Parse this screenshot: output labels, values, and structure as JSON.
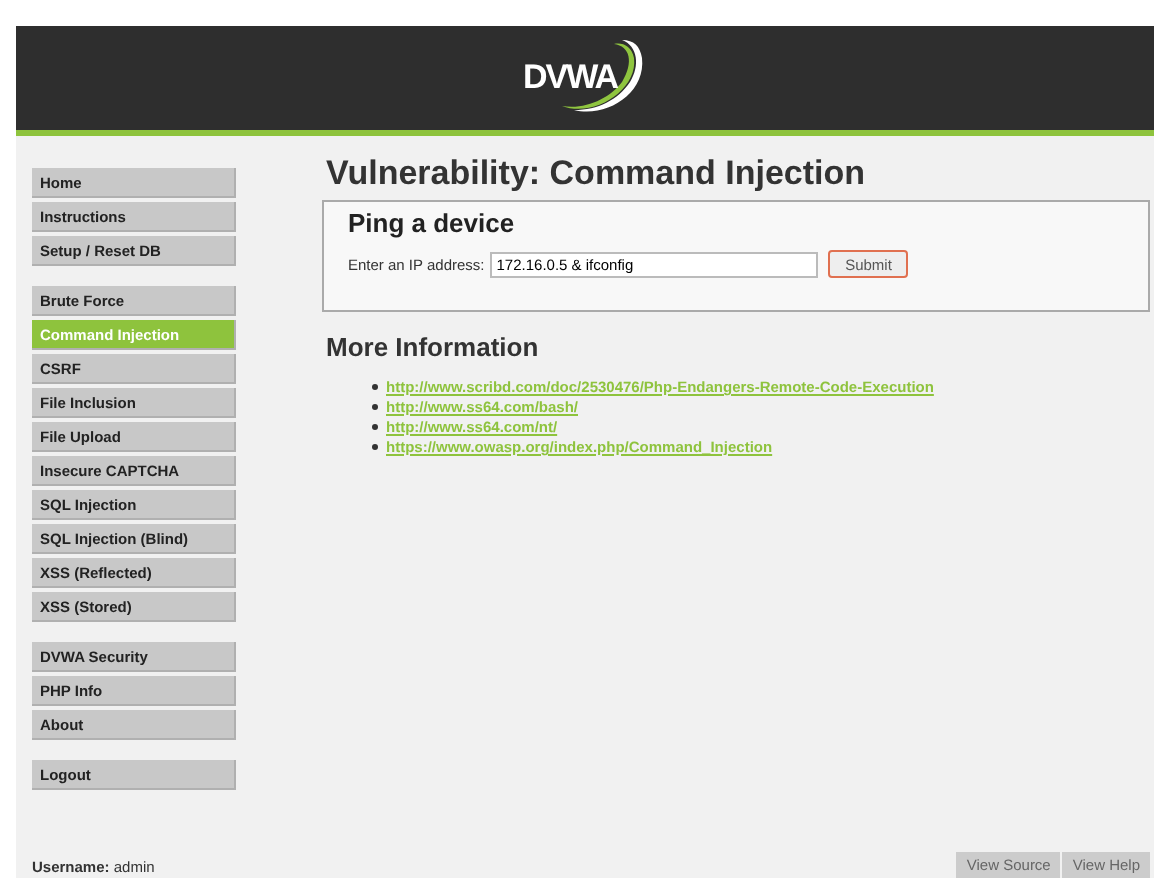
{
  "header": {
    "logo": "DVWA"
  },
  "menu": [
    [
      {
        "label": "Home",
        "selected": false
      },
      {
        "label": "Instructions",
        "selected": false
      },
      {
        "label": "Setup / Reset DB",
        "selected": false
      }
    ],
    [
      {
        "label": "Brute Force",
        "selected": false
      },
      {
        "label": "Command Injection",
        "selected": true
      },
      {
        "label": "CSRF",
        "selected": false
      },
      {
        "label": "File Inclusion",
        "selected": false
      },
      {
        "label": "File Upload",
        "selected": false
      },
      {
        "label": "Insecure CAPTCHA",
        "selected": false
      },
      {
        "label": "SQL Injection",
        "selected": false
      },
      {
        "label": "SQL Injection (Blind)",
        "selected": false
      },
      {
        "label": "XSS (Reflected)",
        "selected": false
      },
      {
        "label": "XSS (Stored)",
        "selected": false
      }
    ],
    [
      {
        "label": "DVWA Security",
        "selected": false
      },
      {
        "label": "PHP Info",
        "selected": false
      },
      {
        "label": "About",
        "selected": false
      }
    ],
    [
      {
        "label": "Logout",
        "selected": false
      }
    ]
  ],
  "title": "Vulnerability: Command Injection",
  "form": {
    "heading": "Ping a device",
    "label": "Enter an IP address:",
    "value": "172.16.0.5 & ifconfig",
    "button": "Submit"
  },
  "more_info": {
    "heading": "More Information",
    "links": [
      "http://www.scribd.com/doc/2530476/Php-Endangers-Remote-Code-Execution",
      "http://www.ss64.com/bash/",
      "http://www.ss64.com/nt/",
      "https://www.owasp.org/index.php/Command_Injection"
    ]
  },
  "user": {
    "label": "Username:",
    "value": "admin"
  },
  "footer_buttons": [
    "View Source",
    "View Help"
  ]
}
